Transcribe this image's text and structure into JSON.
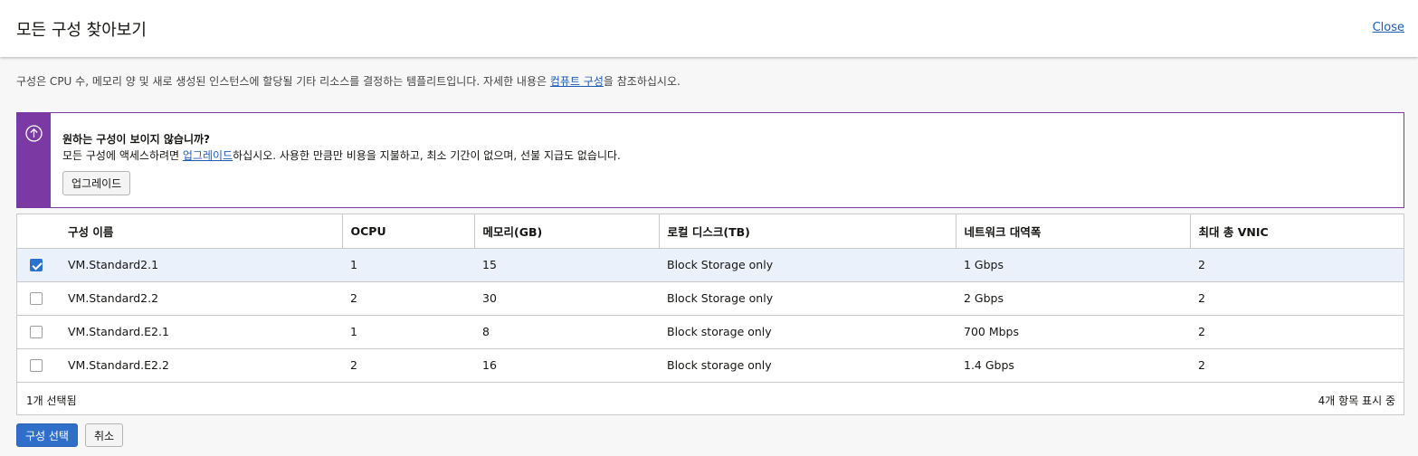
{
  "header": {
    "title": "모든 구성 찾아보기",
    "close_label": "Close"
  },
  "description": {
    "text_before": "구성은 CPU 수, 메모리 양 및 새로 생성된 인스턴스에 할당될 기타 리소스를 결정하는 템플리트입니다. 자세한 내용은 ",
    "link": "컴퓨트 구성",
    "text_after": "을 참조하십시오."
  },
  "callout": {
    "icon": "arrow-up-circle-icon",
    "title": "원하는 구성이 보이지 않습니까?",
    "body_before": "모든 구성에 액세스하려면 ",
    "body_link": "업그레이드",
    "body_after": "하십시오. 사용한 만큼만 비용을 지불하고, 최소 기간이 없으며, 선불 지급도 없습니다.",
    "button_label": "업그레이드",
    "accent_color": "#7b3aa3"
  },
  "table": {
    "columns": [
      "구성 이름",
      "OCPU",
      "메모리(GB)",
      "로컬 디스크(TB)",
      "네트워크 대역폭",
      "최대 총 VNIC"
    ],
    "rows": [
      {
        "checked": true,
        "name": "VM.Standard2.1",
        "ocpu": "1",
        "memory": "15",
        "disk": "Block Storage only",
        "bandwidth": "1 Gbps",
        "vnic": "2"
      },
      {
        "checked": false,
        "name": "VM.Standard2.2",
        "ocpu": "2",
        "memory": "30",
        "disk": "Block Storage only",
        "bandwidth": "2 Gbps",
        "vnic": "2"
      },
      {
        "checked": false,
        "name": "VM.Standard.E2.1",
        "ocpu": "1",
        "memory": "8",
        "disk": "Block storage only",
        "bandwidth": "700 Mbps",
        "vnic": "2"
      },
      {
        "checked": false,
        "name": "VM.Standard.E2.2",
        "ocpu": "2",
        "memory": "16",
        "disk": "Block storage only",
        "bandwidth": "1.4 Gbps",
        "vnic": "2"
      }
    ],
    "selected_text": "1개 선택됨",
    "count_text": "4개 항목 표시 중"
  },
  "actions": {
    "select_label": "구성 선택",
    "cancel_label": "취소"
  },
  "colors": {
    "primary": "#2f6fc9",
    "link": "#1d5cb6",
    "selected_row": "#eaf1fa"
  }
}
